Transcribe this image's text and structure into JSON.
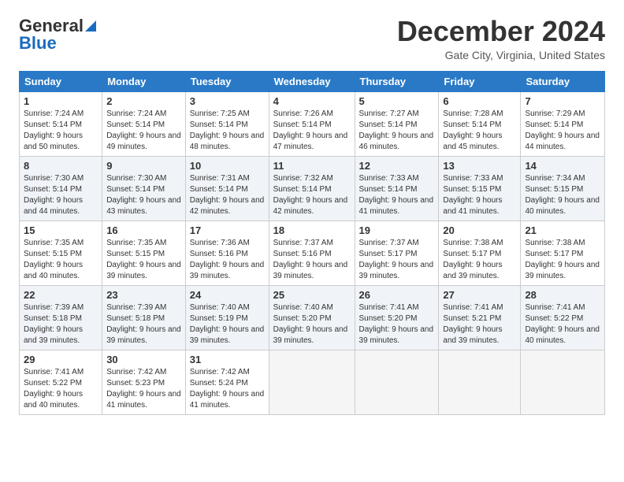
{
  "logo": {
    "line1": "General",
    "line2": "Blue"
  },
  "header": {
    "month": "December 2024",
    "location": "Gate City, Virginia, United States"
  },
  "weekdays": [
    "Sunday",
    "Monday",
    "Tuesday",
    "Wednesday",
    "Thursday",
    "Friday",
    "Saturday"
  ],
  "weeks": [
    [
      {
        "day": "1",
        "sunrise": "7:24 AM",
        "sunset": "5:14 PM",
        "daylight": "9 hours and 50 minutes."
      },
      {
        "day": "2",
        "sunrise": "7:24 AM",
        "sunset": "5:14 PM",
        "daylight": "9 hours and 49 minutes."
      },
      {
        "day": "3",
        "sunrise": "7:25 AM",
        "sunset": "5:14 PM",
        "daylight": "9 hours and 48 minutes."
      },
      {
        "day": "4",
        "sunrise": "7:26 AM",
        "sunset": "5:14 PM",
        "daylight": "9 hours and 47 minutes."
      },
      {
        "day": "5",
        "sunrise": "7:27 AM",
        "sunset": "5:14 PM",
        "daylight": "9 hours and 46 minutes."
      },
      {
        "day": "6",
        "sunrise": "7:28 AM",
        "sunset": "5:14 PM",
        "daylight": "9 hours and 45 minutes."
      },
      {
        "day": "7",
        "sunrise": "7:29 AM",
        "sunset": "5:14 PM",
        "daylight": "9 hours and 44 minutes."
      }
    ],
    [
      {
        "day": "8",
        "sunrise": "7:30 AM",
        "sunset": "5:14 PM",
        "daylight": "9 hours and 44 minutes."
      },
      {
        "day": "9",
        "sunrise": "7:30 AM",
        "sunset": "5:14 PM",
        "daylight": "9 hours and 43 minutes."
      },
      {
        "day": "10",
        "sunrise": "7:31 AM",
        "sunset": "5:14 PM",
        "daylight": "9 hours and 42 minutes."
      },
      {
        "day": "11",
        "sunrise": "7:32 AM",
        "sunset": "5:14 PM",
        "daylight": "9 hours and 42 minutes."
      },
      {
        "day": "12",
        "sunrise": "7:33 AM",
        "sunset": "5:14 PM",
        "daylight": "9 hours and 41 minutes."
      },
      {
        "day": "13",
        "sunrise": "7:33 AM",
        "sunset": "5:15 PM",
        "daylight": "9 hours and 41 minutes."
      },
      {
        "day": "14",
        "sunrise": "7:34 AM",
        "sunset": "5:15 PM",
        "daylight": "9 hours and 40 minutes."
      }
    ],
    [
      {
        "day": "15",
        "sunrise": "7:35 AM",
        "sunset": "5:15 PM",
        "daylight": "9 hours and 40 minutes."
      },
      {
        "day": "16",
        "sunrise": "7:35 AM",
        "sunset": "5:15 PM",
        "daylight": "9 hours and 39 minutes."
      },
      {
        "day": "17",
        "sunrise": "7:36 AM",
        "sunset": "5:16 PM",
        "daylight": "9 hours and 39 minutes."
      },
      {
        "day": "18",
        "sunrise": "7:37 AM",
        "sunset": "5:16 PM",
        "daylight": "9 hours and 39 minutes."
      },
      {
        "day": "19",
        "sunrise": "7:37 AM",
        "sunset": "5:17 PM",
        "daylight": "9 hours and 39 minutes."
      },
      {
        "day": "20",
        "sunrise": "7:38 AM",
        "sunset": "5:17 PM",
        "daylight": "9 hours and 39 minutes."
      },
      {
        "day": "21",
        "sunrise": "7:38 AM",
        "sunset": "5:17 PM",
        "daylight": "9 hours and 39 minutes."
      }
    ],
    [
      {
        "day": "22",
        "sunrise": "7:39 AM",
        "sunset": "5:18 PM",
        "daylight": "9 hours and 39 minutes."
      },
      {
        "day": "23",
        "sunrise": "7:39 AM",
        "sunset": "5:18 PM",
        "daylight": "9 hours and 39 minutes."
      },
      {
        "day": "24",
        "sunrise": "7:40 AM",
        "sunset": "5:19 PM",
        "daylight": "9 hours and 39 minutes."
      },
      {
        "day": "25",
        "sunrise": "7:40 AM",
        "sunset": "5:20 PM",
        "daylight": "9 hours and 39 minutes."
      },
      {
        "day": "26",
        "sunrise": "7:41 AM",
        "sunset": "5:20 PM",
        "daylight": "9 hours and 39 minutes."
      },
      {
        "day": "27",
        "sunrise": "7:41 AM",
        "sunset": "5:21 PM",
        "daylight": "9 hours and 39 minutes."
      },
      {
        "day": "28",
        "sunrise": "7:41 AM",
        "sunset": "5:22 PM",
        "daylight": "9 hours and 40 minutes."
      }
    ],
    [
      {
        "day": "29",
        "sunrise": "7:41 AM",
        "sunset": "5:22 PM",
        "daylight": "9 hours and 40 minutes."
      },
      {
        "day": "30",
        "sunrise": "7:42 AM",
        "sunset": "5:23 PM",
        "daylight": "9 hours and 41 minutes."
      },
      {
        "day": "31",
        "sunrise": "7:42 AM",
        "sunset": "5:24 PM",
        "daylight": "9 hours and 41 minutes."
      },
      null,
      null,
      null,
      null
    ]
  ],
  "labels": {
    "sunrise": "Sunrise:",
    "sunset": "Sunset:",
    "daylight": "Daylight:"
  }
}
